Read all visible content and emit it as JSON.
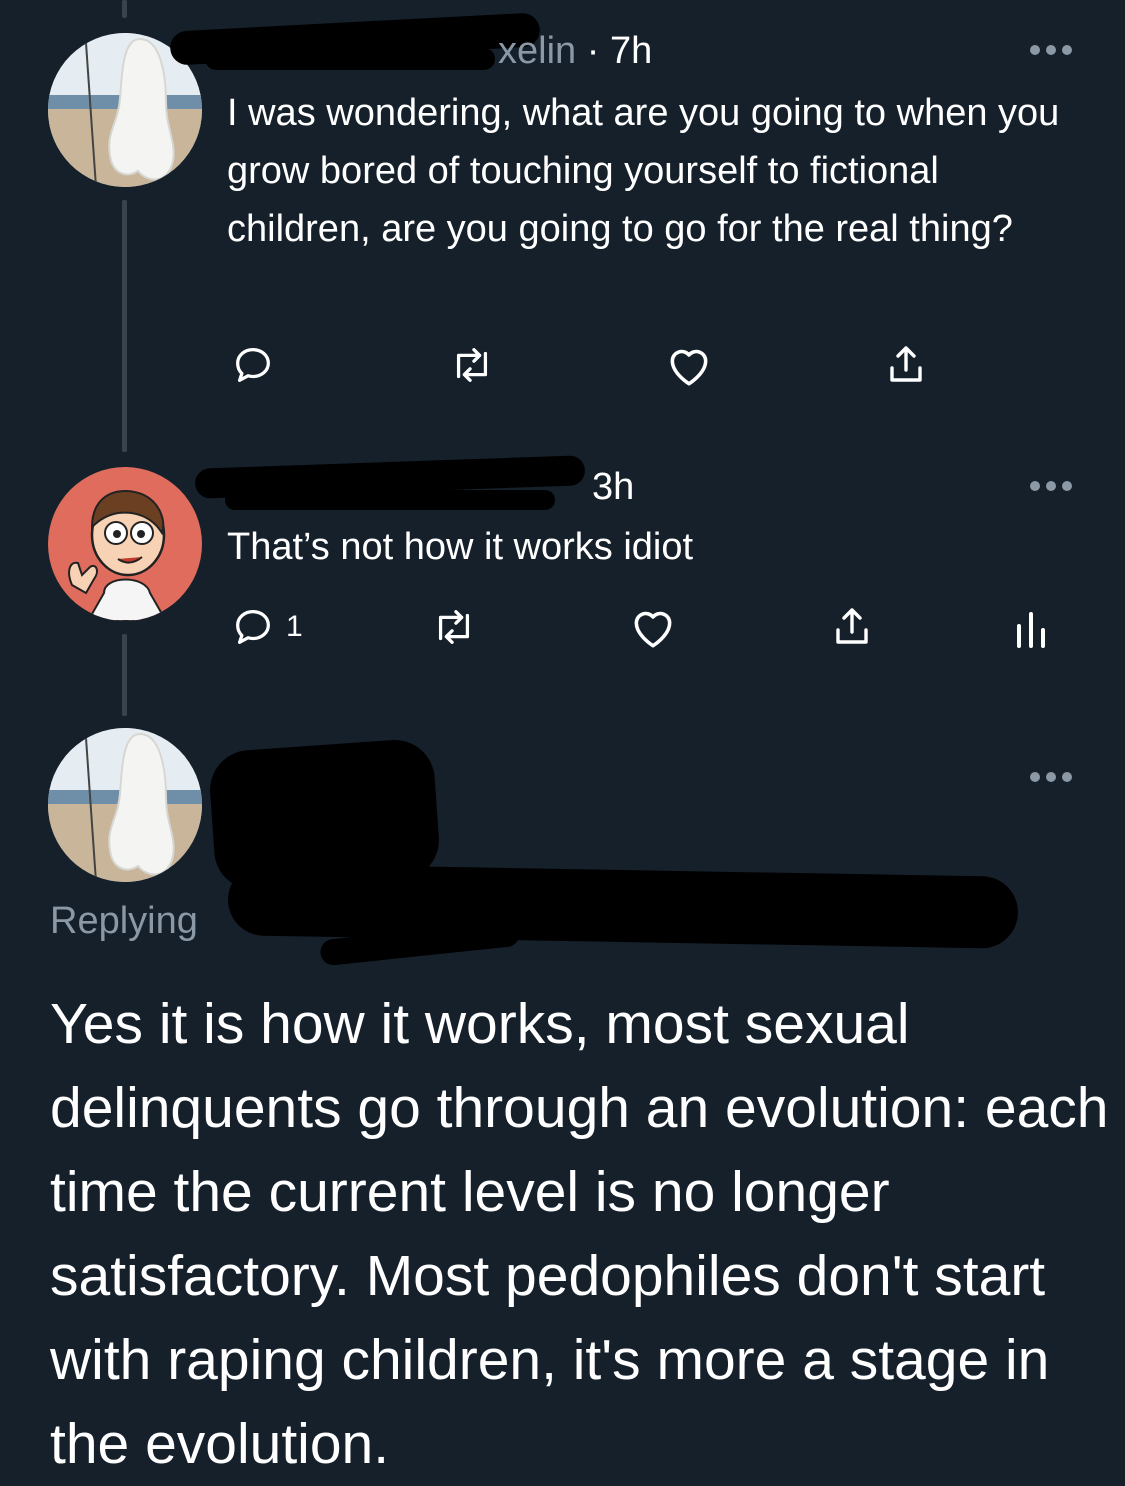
{
  "tweets": [
    {
      "handle_fragment": "xelin",
      "separator": "·",
      "time": "7h",
      "text": "I was wondering, what are you going to when you grow bored of touching yourself to fictional children, are you going to go for the real thing?",
      "avatar_icon": "sculpture-on-beach-avatar"
    },
    {
      "time": "3h",
      "text": "That’s not how it works idiot",
      "reply_count": "1",
      "avatar_icon": "cartoon-boy-waving-avatar"
    },
    {
      "replying_prefix": "Replying",
      "text": "Yes it is how it works, most sexual delinquents go through an evolution: each time the current level is no longer satisfactory. Most pedophiles don't start with raping children, it's more a stage in the evolution.",
      "avatar_icon": "sculpture-on-beach-avatar"
    }
  ],
  "colors": {
    "background": "#15202b",
    "text": "#ffffff",
    "muted": "#8b98a5",
    "thread_line": "#38444d",
    "redaction": "#000000"
  }
}
